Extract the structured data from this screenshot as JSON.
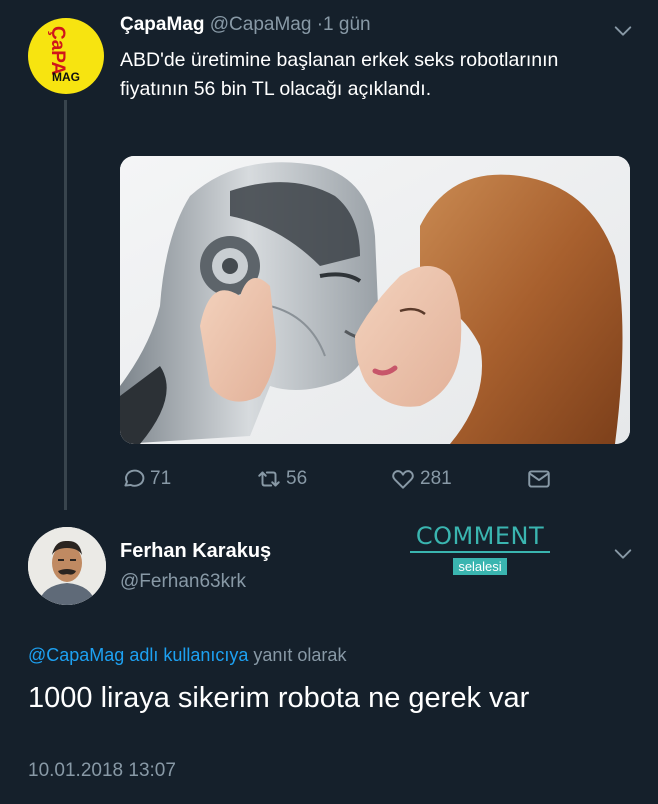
{
  "tweet1": {
    "avatar": {
      "logo_top": "ÇaPA",
      "logo_bottom": "MAG"
    },
    "name": "ÇapaMag",
    "handle": "@CapaMag",
    "dot": "·",
    "time": "1 gün",
    "text": "ABD'de üretimine başlanan erkek seks robotlarının fiyatının 56 bin TL olacağı açıklandı.",
    "media_icon": "robot-woman-photo",
    "actions": {
      "reply_count": "71",
      "retweet_count": "56",
      "like_count": "281"
    }
  },
  "watermark": {
    "top": "COMMENT",
    "bottom": "selalesi"
  },
  "tweet2": {
    "name": "Ferhan Karakuş",
    "handle": "@Ferhan63krk",
    "reply_link": "@CapaMag adlı kullanıcıya",
    "reply_suffix": " yanıt olarak",
    "text": "1000 liraya sikerim robota ne gerek var",
    "date": "10.01.2018 13:07"
  },
  "colors": {
    "background": "#15202b",
    "secondary_text": "#8899a6",
    "link": "#1da1f2",
    "watermark": "#3ab5b0",
    "logo_yellow": "#f7e410"
  }
}
